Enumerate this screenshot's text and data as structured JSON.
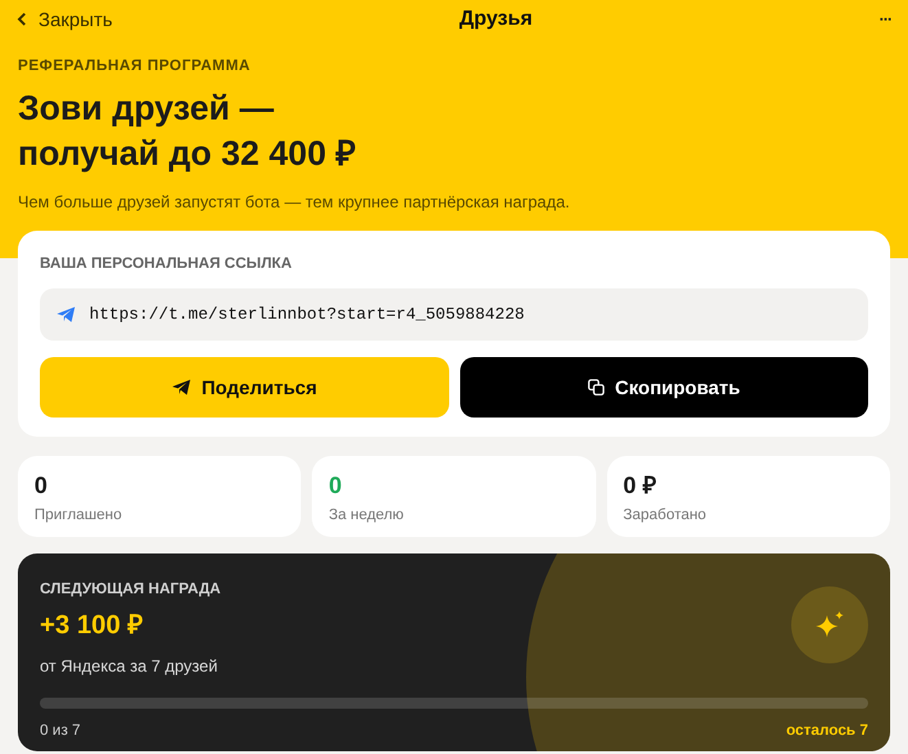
{
  "header": {
    "back": "Закрыть",
    "title": "Друзья",
    "more": "···"
  },
  "hero": {
    "eyebrow": "РЕФЕРАЛЬНАЯ ПРОГРАММА",
    "title_lines": [
      "Зови друзей —",
      "получай до 32 400 ₽"
    ],
    "subtitle": "Чем больше друзей запустят бота — тем крупнее партнёрская награда."
  },
  "link_card": {
    "label": "ВАША ПЕРСОНАЛЬНАЯ ССЫЛКА",
    "url": "https://t.me/sterlinnbot?start=r4_5059884228",
    "buttons": [
      {
        "kind": "share",
        "label": "Поделиться"
      },
      {
        "kind": "copy",
        "label": "Скопировать"
      }
    ]
  },
  "stats": [
    {
      "value": "0",
      "label": "Приглашено",
      "color": "#1a1a1a"
    },
    {
      "value": "0",
      "label": "За неделю",
      "color": "#1faa59"
    },
    {
      "value": "0 ₽",
      "label": "Заработано",
      "color": "#1a1a1a"
    }
  ],
  "reward": {
    "eyebrow": "СЛЕДУЮЩАЯ НАГРАДА",
    "amount": "+3 100 ₽",
    "note": "от Яндекса за 7 друзей",
    "level": 0,
    "progress": "0 из 7",
    "remaining": "осталось 7"
  }
}
